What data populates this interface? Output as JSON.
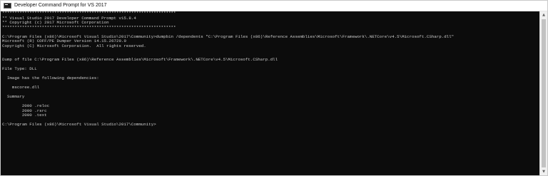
{
  "window": {
    "title": "Developer Command Prompt for VS 2017",
    "icon": "cmd-icon"
  },
  "console": {
    "lines": [
      "**********************************************************************",
      "** Visual Studio 2017 Developer Command Prompt v15.8.4",
      "** Copyright (c) 2017 Microsoft Corporation",
      "**********************************************************************",
      "",
      "C:\\Program Files (x86)\\Microsoft Visual Studio\\2017\\Community>dumpbin /dependents \"C:\\Program Files (x86)\\Reference Assemblies\\Microsoft\\Framework\\.NETCore\\v4.5\\Microsoft.CSharp.dll\"",
      "Microsoft (R) COFF/PE Dumper Version 14.15.26729.0",
      "Copyright (C) Microsoft Corporation.  All rights reserved.",
      "",
      "",
      "Dump of file C:\\Program Files (x86)\\Reference Assemblies\\Microsoft\\Framework\\.NETCore\\v4.5\\Microsoft.CSharp.dll",
      "",
      "File Type: DLL",
      "",
      "  Image has the following dependencies:",
      "",
      "    mscoree.dll",
      "",
      "  Summary",
      "",
      "        2000 .reloc",
      "        2000 .rsrc",
      "        2000 .text",
      "",
      "C:\\Program Files (x86)\\Microsoft Visual Studio\\2017\\Community>"
    ]
  },
  "colors": {
    "console_background": "#0c0c0c",
    "console_text": "#cccccc"
  }
}
